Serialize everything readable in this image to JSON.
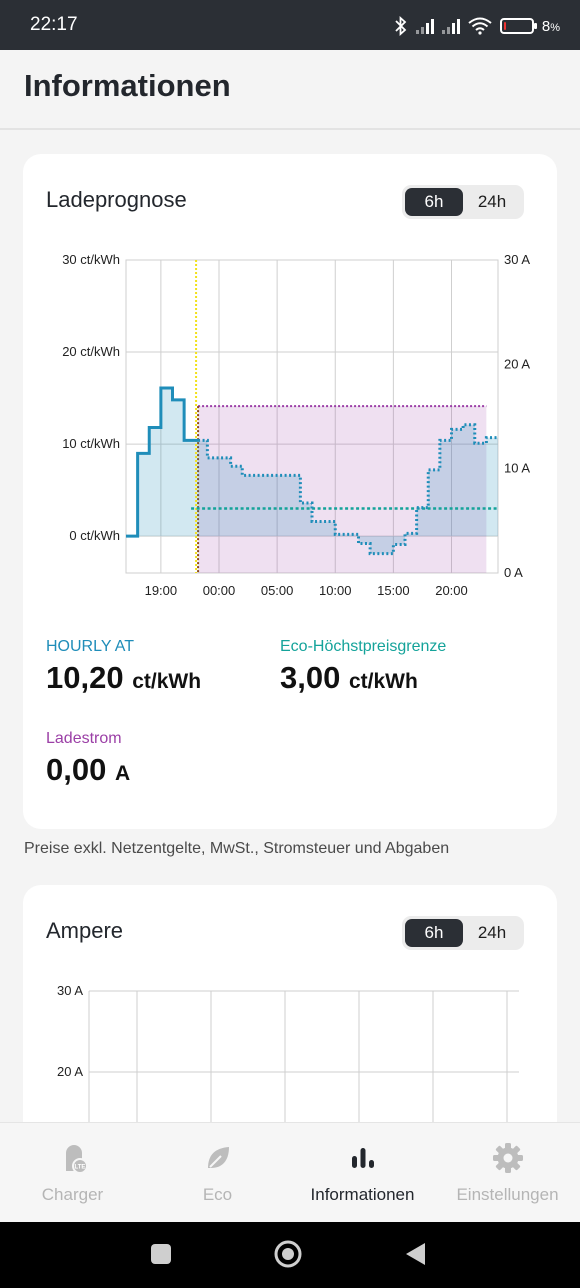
{
  "status_bar": {
    "time": "22:17",
    "battery_level": "8",
    "battery_unit": "%",
    "battery_fraction": 0.08
  },
  "header": {
    "title": "Informationen"
  },
  "forecast_card": {
    "title": "Ladeprognose",
    "range_options": [
      "6h",
      "24h"
    ],
    "selected_range": "6h",
    "metrics": [
      {
        "label": "HOURLY AT",
        "value": "10,20",
        "unit": "ct/kWh",
        "color": "#1f8db9"
      },
      {
        "label": "Eco-Höchstpreisgrenze",
        "value": "3,00",
        "unit": "ct/kWh",
        "color": "#14a39a"
      },
      {
        "label": "Ladestrom",
        "value": "0,00",
        "unit": "A",
        "color": "#9b3fa6"
      }
    ]
  },
  "footnote": "Preise exkl. Netzentgelte, MwSt., Stromsteuer und Abgaben",
  "ampere_card": {
    "title": "Ampere",
    "range_options": [
      "6h",
      "24h"
    ],
    "selected_range": "6h"
  },
  "chart_data": [
    {
      "type": "line",
      "y_left_ticks": [
        "0 ct/kWh",
        "10 ct/kWh",
        "20 ct/kWh",
        "30 ct/kWh"
      ],
      "y_right_ticks": [
        "0 A",
        "10 A",
        "20 A",
        "30 A"
      ],
      "x_ticks": [
        "19:00",
        "00:00",
        "05:00",
        "10:00",
        "15:00",
        "20:00"
      ],
      "ylim_left": [
        -4,
        30
      ],
      "ylim_right": [
        0,
        30
      ],
      "grid": true,
      "series": [
        {
          "kind": "past price, solid step",
          "color": "#1f8db9",
          "points": [
            [
              -0.5,
              0
            ],
            [
              0.5,
              0
            ],
            [
              0.5,
              9
            ],
            [
              1.5,
              9
            ],
            [
              1.5,
              11.8
            ],
            [
              2.5,
              11.8
            ],
            [
              2.5,
              16.1
            ],
            [
              3.5,
              16.1
            ],
            [
              3.5,
              14.8
            ],
            [
              4.5,
              14.8
            ],
            [
              4.5,
              10.4
            ],
            [
              5.7,
              10.4
            ]
          ]
        },
        {
          "kind": "forecast price, dotted step",
          "color": "#1f8db9",
          "points": [
            [
              5.7,
              10.4
            ],
            [
              6.5,
              10.4
            ],
            [
              6.5,
              8.5
            ],
            [
              8.5,
              8.5
            ],
            [
              8.5,
              7.6
            ],
            [
              9.5,
              7.6
            ],
            [
              9.5,
              6.6
            ],
            [
              14.5,
              6.6
            ],
            [
              14.5,
              3.6
            ],
            [
              15.5,
              3.6
            ],
            [
              15.5,
              1.6
            ],
            [
              17.5,
              1.6
            ],
            [
              17.5,
              0.2
            ],
            [
              19.5,
              0.2
            ],
            [
              19.5,
              -0.8
            ],
            [
              20.5,
              -0.8
            ],
            [
              20.5,
              -1.9
            ],
            [
              22.5,
              -1.9
            ],
            [
              22.5,
              -0.9
            ],
            [
              23.5,
              -0.9
            ],
            [
              23.5,
              0.3
            ],
            [
              24.5,
              0.3
            ],
            [
              24.5,
              3.1
            ],
            [
              25.5,
              3.1
            ],
            [
              25.5,
              7.2
            ],
            [
              26.5,
              7.2
            ],
            [
              26.5,
              10.4
            ],
            [
              27.5,
              10.4
            ],
            [
              27.5,
              11.6
            ],
            [
              28.5,
              11.6
            ],
            [
              28.5,
              12.1
            ],
            [
              29.5,
              12.1
            ],
            [
              29.5,
              10.1
            ],
            [
              30.5,
              10.1
            ],
            [
              30.5,
              10.7
            ],
            [
              31.5,
              10.7
            ]
          ]
        },
        {
          "kind": "eco price limit, dotted",
          "color": "#14a39a",
          "points": [
            [
              5.1,
              3
            ],
            [
              31.5,
              3
            ]
          ]
        },
        {
          "kind": "charging current window, dotted, right axis",
          "color": "#9b3fa6",
          "axis": "right",
          "from": 5.7,
          "to": 30.5,
          "value_a": 16
        }
      ],
      "now_marker": {
        "color": "#f2e21a",
        "x": 5.7
      }
    },
    {
      "type": "line",
      "y_ticks": [
        "20 A",
        "30 A"
      ],
      "ylim_visible": [
        18,
        30
      ],
      "grid": true,
      "series": []
    }
  ],
  "nav": {
    "items": [
      {
        "label": "Charger",
        "icon": "charger-icon",
        "badge": "LTE",
        "active": false
      },
      {
        "label": "Eco",
        "icon": "leaf-icon",
        "active": false
      },
      {
        "label": "Informationen",
        "icon": "bar-chart-icon",
        "active": true
      },
      {
        "label": "Einstellungen",
        "icon": "gear-icon",
        "active": false
      }
    ]
  }
}
